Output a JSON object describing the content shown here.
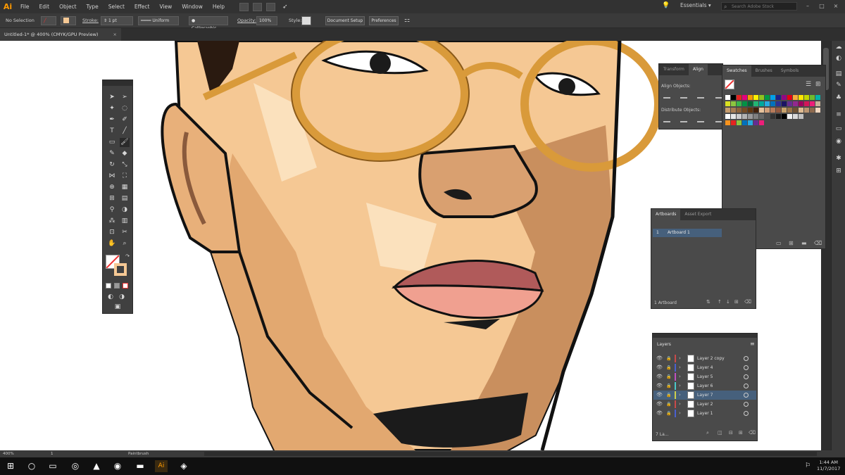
{
  "app": {
    "logo": "Ai"
  },
  "menu": [
    "File",
    "Edit",
    "Object",
    "Type",
    "Select",
    "Effect",
    "View",
    "Window",
    "Help"
  ],
  "workspace": "Essentials",
  "search_placeholder": "Search Adobe Stock",
  "control_bar": {
    "selection": "No Selection",
    "stroke_label": "Stroke:",
    "stroke_weight": "1 pt",
    "profile": "Uniform",
    "brush": "Calligraphic...",
    "opacity_label": "Opacity:",
    "opacity_value": "100%",
    "style_label": "Style:",
    "document_setup": "Document Setup",
    "preferences": "Preferences"
  },
  "doc_tab": {
    "title": "Untitled-1* @ 400% (CMYK/GPU Preview)",
    "close": "×"
  },
  "align_panel": {
    "tabs": [
      "Transform",
      "Align"
    ],
    "align_objects": "Align Objects:",
    "distribute_objects": "Distribute Objects:"
  },
  "swatches_panel": {
    "tabs": [
      "Swatches",
      "Brushes",
      "Symbols"
    ],
    "colors_row1": [
      "#ffffff",
      "#000000",
      "#e52421",
      "#e4007f",
      "#f39800",
      "#fff100",
      "#8fc31f",
      "#009944",
      "#00a0e9",
      "#1d2088",
      "#920783",
      "#e60012",
      "#f6ad3c",
      "#ffe600",
      "#c3d600",
      "#6fba2c",
      "#00b3a9",
      "#00a0c1",
      "#036eb8",
      "#5f52a0"
    ],
    "colors_row2": [
      "#d9e021",
      "#8cc63f",
      "#39b54a",
      "#009245",
      "#006837",
      "#22b573",
      "#00a99d",
      "#29abe2",
      "#0071bc",
      "#2e3192",
      "#1b1464",
      "#662d91",
      "#93278f",
      "#9e005d",
      "#d4145a",
      "#ed1e79",
      "#c7b299",
      "#998675",
      "#736357",
      "#534741"
    ],
    "colors_row3": [
      "#c69c6d",
      "#a67c52",
      "#8c6239",
      "#754c24",
      "#603813",
      "#42210b",
      "#e6c29c",
      "#d19f7a",
      "#b77b5a",
      "#93583f",
      "#c8a26c",
      "#9a7348",
      "#6f5233",
      "#dfbb91",
      "#bb9470",
      "#8e6a4f",
      "#f2d7bf",
      "#d9a57a",
      "#b8845a",
      "#8a5a3c"
    ],
    "colors_row4": [
      "#ffffff",
      "#e6e6e6",
      "#cccccc",
      "#b3b3b3",
      "#999999",
      "#808080",
      "#666666",
      "#4d4d4d",
      "#333333",
      "#1a1a1a",
      "#000000",
      "#f0f0f0",
      "#dadada",
      "#c0c0c0"
    ],
    "colors_row5": [
      "#f7931e",
      "#e52421",
      "#8cc63f",
      "#0071bc",
      "#29abe2",
      "#662d91",
      "#ed1e79"
    ]
  },
  "artboards_panel": {
    "tabs": [
      "Artboards",
      "Asset Export"
    ],
    "row_number": "1",
    "row_name": "Artboard 1",
    "footer": "1 Artboard"
  },
  "layers_panel": {
    "title": "Layers",
    "layers": [
      {
        "name": "Layer 2 copy",
        "color": "#c94a4a",
        "selected": false
      },
      {
        "name": "Layer 4",
        "color": "#4a60d0",
        "selected": false
      },
      {
        "name": "Layer 5",
        "color": "#c04fc0",
        "selected": false
      },
      {
        "name": "Layer 6",
        "color": "#4ac9c9",
        "selected": false
      },
      {
        "name": "Layer 7",
        "color": "#cfcf4a",
        "selected": true
      },
      {
        "name": "Layer 2",
        "color": "#c94a4a",
        "selected": false
      },
      {
        "name": "Layer 1",
        "color": "#4a60d0",
        "selected": false
      }
    ],
    "footer": "7 La..."
  },
  "status_bar": {
    "zoom": "400%",
    "page": "1",
    "tool": "Paintbrush"
  },
  "taskbar": {
    "time": "1:44 AM",
    "date": "11/7/2017"
  },
  "colors": {
    "accent": "#ff9a00",
    "selection": "#46607c",
    "skin": "#f5c894",
    "skin_shadow": "#c98f5e",
    "glasses": "#d99a3a",
    "lips": "#b05a5a"
  }
}
